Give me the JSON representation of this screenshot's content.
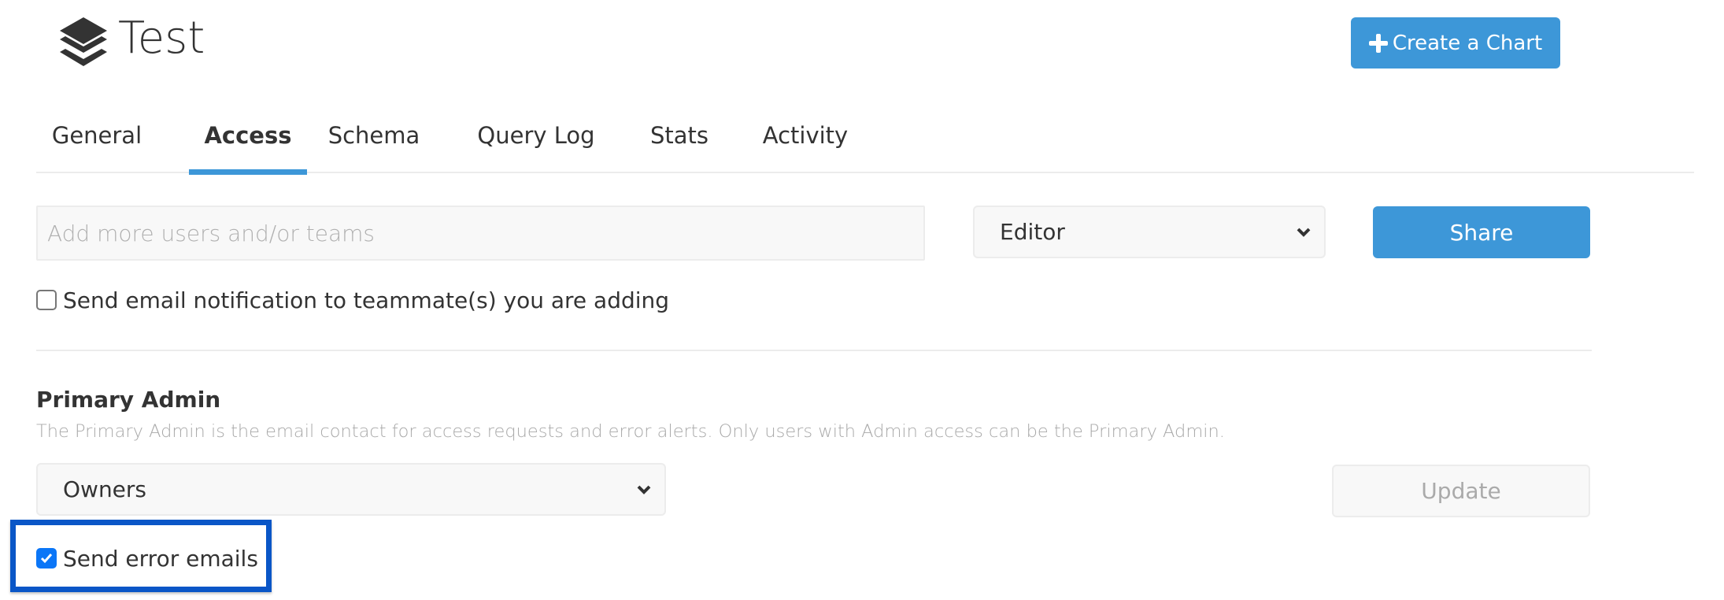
{
  "header": {
    "title": "Test",
    "logo_icon": "layers-icon",
    "create_chart_label": "Create a Chart",
    "create_chart_icon": "plus-icon"
  },
  "tabs": [
    {
      "label": "General",
      "active": false
    },
    {
      "label": "Access",
      "active": true
    },
    {
      "label": "Schema",
      "active": false
    },
    {
      "label": "Query Log",
      "active": false
    },
    {
      "label": "Stats",
      "active": false
    },
    {
      "label": "Activity",
      "active": false
    }
  ],
  "share": {
    "input_placeholder": "Add more users and/or teams",
    "input_value": "",
    "role_selected": "Editor",
    "share_label": "Share",
    "notify_label": "Send email notification to teammate(s) you are adding",
    "notify_checked": false
  },
  "primary_admin": {
    "title": "Primary Admin",
    "description": "The Primary Admin is the email contact for access requests and error alerts. Only users with Admin access can be the Primary Admin.",
    "selected": "Owners",
    "update_label": "Update",
    "send_error_label": "Send error emails",
    "send_error_checked": true
  },
  "colors": {
    "accent": "#3d97d8",
    "highlight": "#0a56c7",
    "checkbox_checked": "#0b76f7"
  }
}
